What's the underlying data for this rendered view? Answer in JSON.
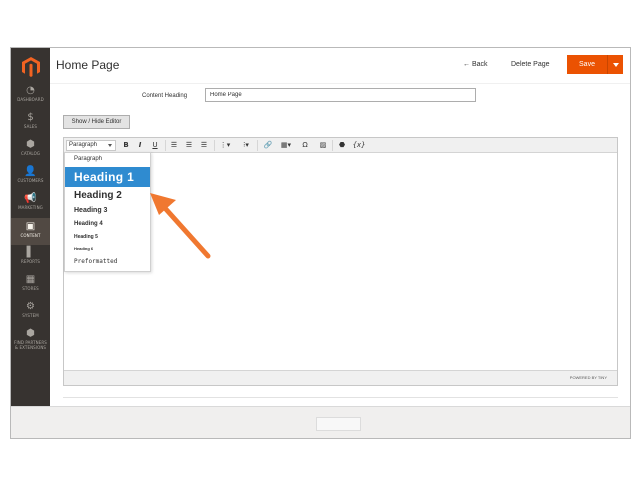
{
  "header": {
    "title": "Home Page",
    "back_label": "Back",
    "back_icon": "←",
    "delete_label": "Delete Page",
    "save_label": "Save"
  },
  "sidebar": {
    "items": [
      {
        "label": "DASHBOARD",
        "icon": "dashboard-icon",
        "glyph": "◔"
      },
      {
        "label": "SALES",
        "icon": "dollar-icon",
        "glyph": "$"
      },
      {
        "label": "CATALOG",
        "icon": "cube-icon",
        "glyph": "⬢"
      },
      {
        "label": "CUSTOMERS",
        "icon": "person-icon",
        "glyph": "👤"
      },
      {
        "label": "MARKETING",
        "icon": "megaphone-icon",
        "glyph": "📢"
      },
      {
        "label": "CONTENT",
        "icon": "layout-icon",
        "glyph": "▣",
        "active": true
      },
      {
        "label": "REPORTS",
        "icon": "bar-chart-icon",
        "glyph": "▌"
      },
      {
        "label": "STORES",
        "icon": "store-icon",
        "glyph": "▦"
      },
      {
        "label": "SYSTEM",
        "icon": "gear-icon",
        "glyph": "⚙"
      },
      {
        "label": "FIND PARTNERS & EXTENSIONS",
        "icon": "box-icon",
        "glyph": "⬢"
      }
    ]
  },
  "form": {
    "content_heading_label": "Content Heading",
    "content_heading_value": "Home Page",
    "show_hide_label": "Show / Hide Editor"
  },
  "editor": {
    "format_selected": "Paragraph",
    "toolbar": {
      "bold": "B",
      "italic": "I",
      "underline": "U",
      "special_char": "Ω",
      "variable": "{x}"
    },
    "formats": [
      "Paragraph",
      "Heading 1",
      "Heading 2",
      "Heading 3",
      "Heading 4",
      "Heading 5",
      "Heading 6",
      "Preformatted"
    ],
    "highlighted_format": "Heading 1",
    "powered_by": "POWERED BY TINY"
  },
  "colors": {
    "accent": "#eb5202",
    "sidebar_bg": "#373330",
    "highlight": "#2f8bd0",
    "arrow": "#f07830"
  }
}
